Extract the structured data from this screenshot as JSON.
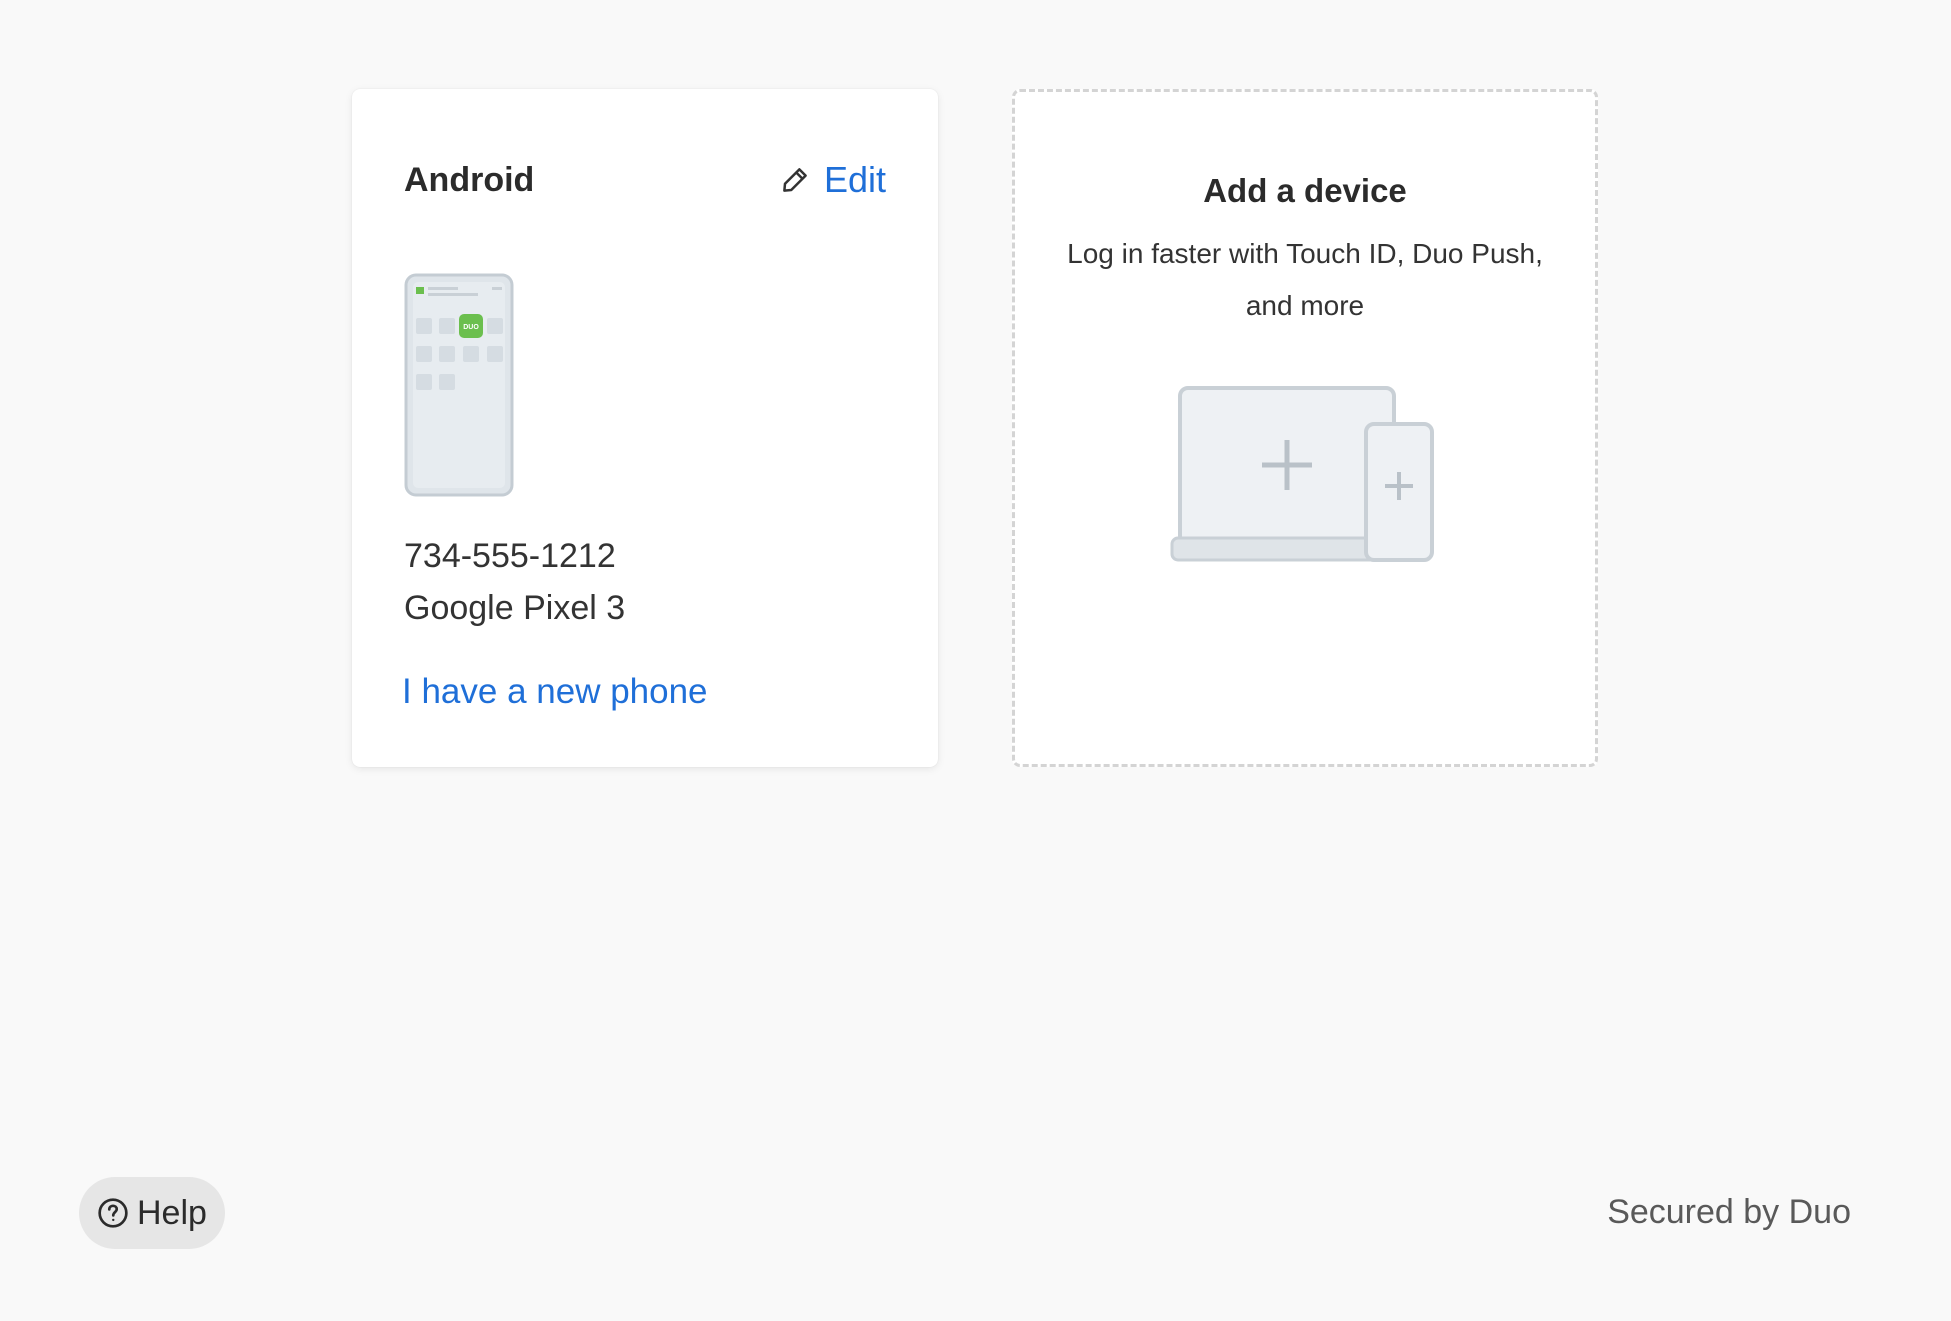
{
  "device_card": {
    "platform": "Android",
    "edit_label": "Edit",
    "phone_number": "734-555-1212",
    "model": "Google Pixel 3",
    "new_phone_link": "I have a new phone",
    "app_badge_text": "DUO"
  },
  "add_device_card": {
    "title": "Add a device",
    "description_line1": "Log in faster with Touch ID, Duo Push,",
    "description_line2": "and more"
  },
  "footer": {
    "help_label": "Help",
    "secured_text": "Secured by Duo"
  },
  "colors": {
    "link": "#1f6fd8",
    "duo_green": "#6bbf4e",
    "background": "#f9f9f9"
  }
}
